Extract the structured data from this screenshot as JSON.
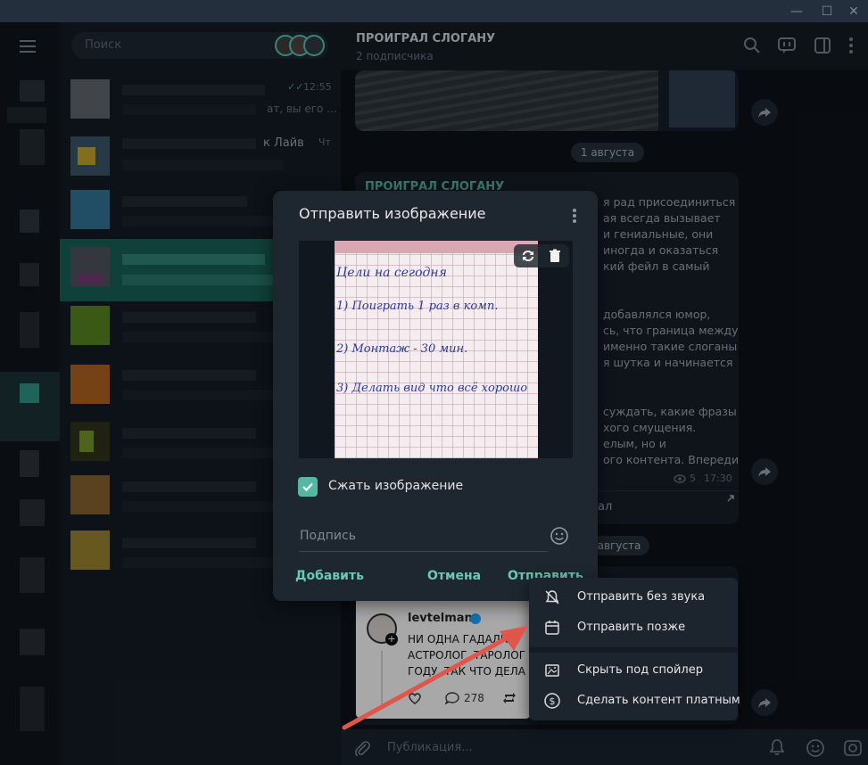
{
  "window": {
    "minimize_glyph": "—",
    "maximize_glyph": "☐",
    "close_glyph": "✕"
  },
  "sidebar": {
    "search_placeholder": "Поиск",
    "chat_fragments": [
      {
        "time": "12:55",
        "preview": "ат, вы его ..."
      },
      {
        "name": "к Лайв",
        "time": "Чт"
      }
    ]
  },
  "chat_header": {
    "title": "ПРОИГРАЛ СЛОГАНУ",
    "subtitle": "2 подписчика"
  },
  "messages": {
    "date1": "1 августа",
    "date2": "августа",
    "channel_name": "ПРОИГРАЛ СЛОГАНУ",
    "text_lines": [
      "я рад присоединиться",
      "ая всегда вызывает",
      "и гениальные, они",
      "иногда и оказаться",
      "кий фейл в самый",
      "",
      "добавлялся юмор,",
      "сь, что граница между",
      "именно такие слоганы",
      "я шутка и начинается",
      "",
      "суждать, какие фразы",
      "хого смущения.",
      "елым, но и",
      "ого контента. Впереди"
    ],
    "views": "5",
    "time": "17:30",
    "link_fragment": "ал"
  },
  "tweet": {
    "author": "levtelman",
    "text_lines": [
      "НИ ОДНА ГАДАЛКА,",
      "АСТРОЛОГ, ТАРОЛОГ",
      "ГОДУ. ТАК ЧТО ДЕЛА"
    ],
    "replies": "278"
  },
  "dialog": {
    "title": "Отправить изображение",
    "compress_label": "Сжать изображение",
    "compress_checked": true,
    "caption_placeholder": "Подпись",
    "add_label": "Добавить",
    "cancel_label": "Отмена",
    "send_label": "Отправить",
    "note_lines": [
      "Цели на сегодня",
      "1) Поиграть 1 раз в комп.",
      "2) Монтаж - 30 мин.",
      "3) Делать вид что всё хорошо"
    ]
  },
  "send_menu": {
    "items": [
      {
        "label": "Отправить без звука",
        "icon": "muted-bell-icon"
      },
      {
        "label": "Отправить позже",
        "icon": "calendar-icon"
      },
      {
        "label": "Скрыть под спойлер",
        "icon": "spoiler-icon"
      },
      {
        "label": "Сделать контент платным",
        "icon": "paid-coin-icon"
      }
    ]
  },
  "composer": {
    "placeholder": "Публикация..."
  },
  "colors": {
    "accent": "#55b7a4",
    "arrow": "#e0564a",
    "background": "#17212b"
  }
}
